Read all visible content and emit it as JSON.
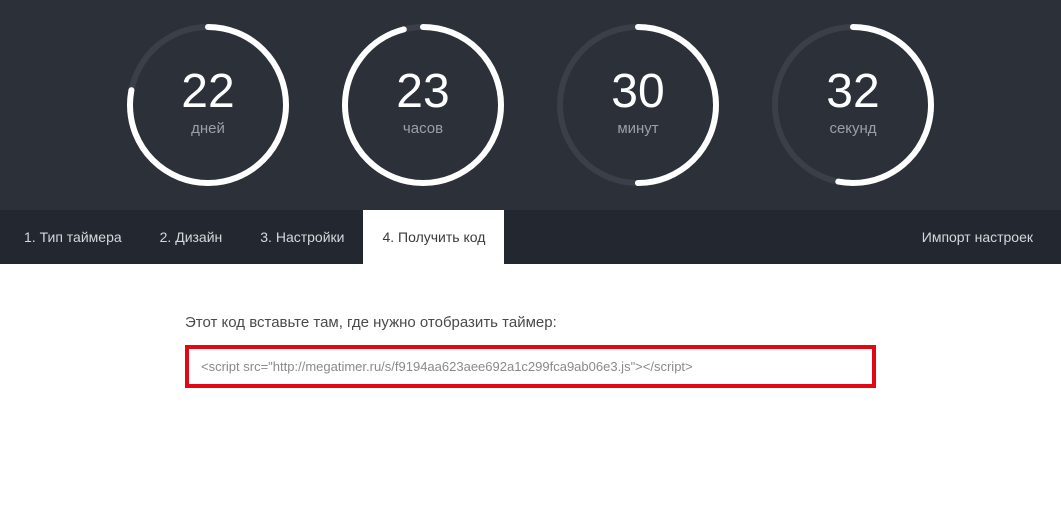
{
  "timers": [
    {
      "value": "22",
      "label": "дней",
      "progress": 0.78
    },
    {
      "value": "23",
      "label": "часов",
      "progress": 0.96
    },
    {
      "value": "30",
      "label": "минут",
      "progress": 0.5
    },
    {
      "value": "32",
      "label": "секунд",
      "progress": 0.53
    }
  ],
  "tabs": [
    {
      "label": "1. Тип таймера",
      "active": false
    },
    {
      "label": "2. Дизайн",
      "active": false
    },
    {
      "label": "3. Настройки",
      "active": false
    },
    {
      "label": "4. Получить код",
      "active": true
    }
  ],
  "import_label": "Импорт настроек",
  "content": {
    "instruction": "Этот код вставьте там, где нужно отобразить таймер:",
    "code": "<script src=\"http://megatimer.ru/s/f9194aa623aee692a1c299fca9ab06e3.js\"></script>"
  },
  "colors": {
    "ring_empty": "#3a3f48",
    "ring_fill": "#ffffff",
    "highlight_border": "#e30613"
  }
}
